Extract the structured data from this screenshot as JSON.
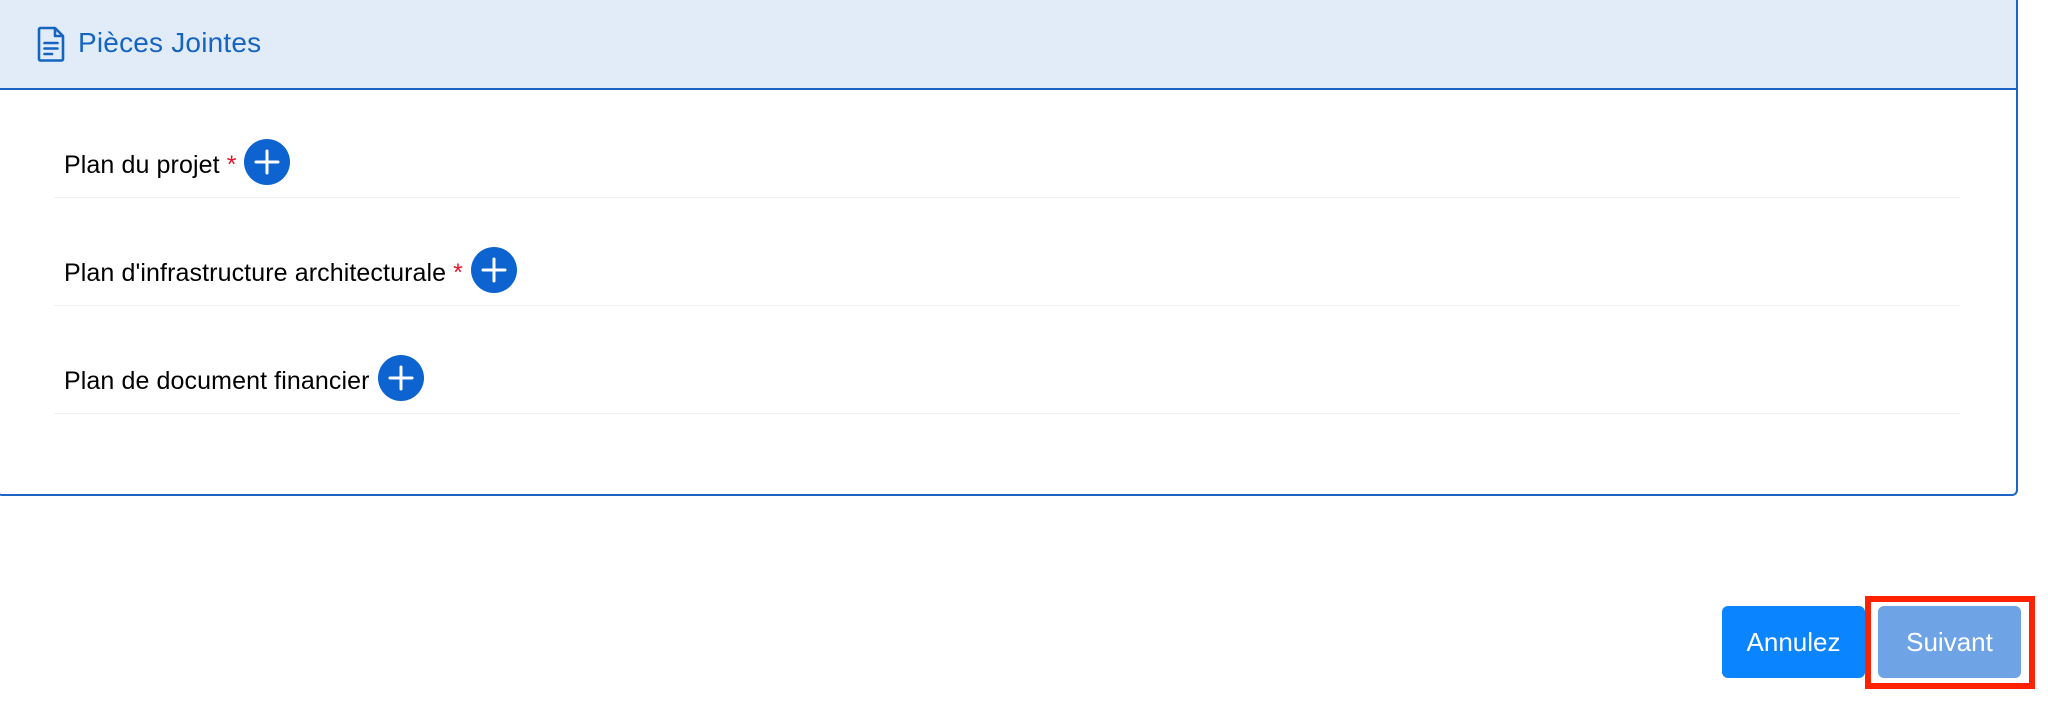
{
  "section": {
    "title": "Pièces Jointes",
    "icon": "document-icon"
  },
  "attachments": [
    {
      "label": "Plan du projet",
      "required": true,
      "required_mark": "*",
      "action_icon": "plus-circle-icon"
    },
    {
      "label": "Plan d'infrastructure architecturale",
      "required": true,
      "required_mark": "*",
      "action_icon": "plus-circle-icon"
    },
    {
      "label": "Plan de document financier",
      "required": false,
      "required_mark": "",
      "action_icon": "plus-circle-icon"
    }
  ],
  "footer": {
    "cancel_label": "Annulez",
    "next_label": "Suivant"
  },
  "colors": {
    "primary": "#1d64c4",
    "header_bg": "#e1ecf8",
    "required": "#e0192b",
    "cancel_button": "#0a84ff",
    "next_button_disabled": "#6ea3e6",
    "highlight": "#ff2200"
  }
}
